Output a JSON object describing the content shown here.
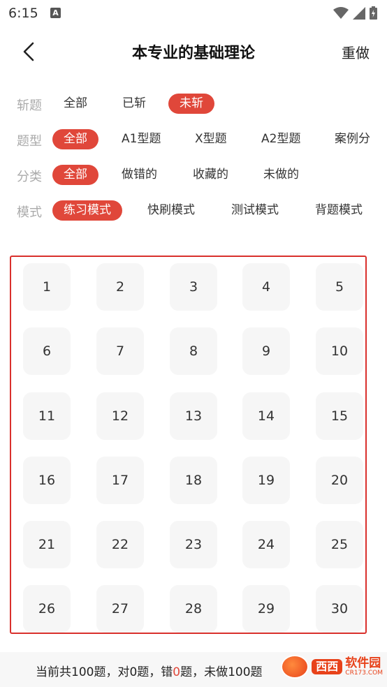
{
  "status_bar": {
    "time": "6:15",
    "notification_icon": "A"
  },
  "header": {
    "back_icon": "chevron-left-icon",
    "title": "本专业的基础理论",
    "reset_label": "重做"
  },
  "filters": [
    {
      "label": "斩题",
      "options": [
        "全部",
        "已斩",
        "未斩"
      ],
      "selected": "未斩"
    },
    {
      "label": "题型",
      "options": [
        "全部",
        "A1型题",
        "X型题",
        "A2型题",
        "案例分"
      ],
      "selected": "全部"
    },
    {
      "label": "分类",
      "options": [
        "全部",
        "做错的",
        "收藏的",
        "未做的"
      ],
      "selected": "全部"
    },
    {
      "label": "模式",
      "options": [
        "练习模式",
        "快刷模式",
        "测试模式",
        "背题模式"
      ],
      "selected": "练习模式"
    }
  ],
  "questions": [
    "1",
    "2",
    "3",
    "4",
    "5",
    "6",
    "7",
    "8",
    "9",
    "10",
    "11",
    "12",
    "13",
    "14",
    "15",
    "16",
    "17",
    "18",
    "19",
    "20",
    "21",
    "22",
    "23",
    "24",
    "25",
    "26",
    "27",
    "28",
    "29",
    "30"
  ],
  "footer": {
    "prefix": "当前共100题，对0题，错",
    "wrong_count": "0",
    "suffix": "题，未做10",
    "cut": "0题"
  },
  "watermark": {
    "brand": "西西",
    "title": "软件园",
    "site": "CR173.COM"
  },
  "colors": {
    "accent": "#e0473a",
    "highlight_border": "#d9302c"
  }
}
